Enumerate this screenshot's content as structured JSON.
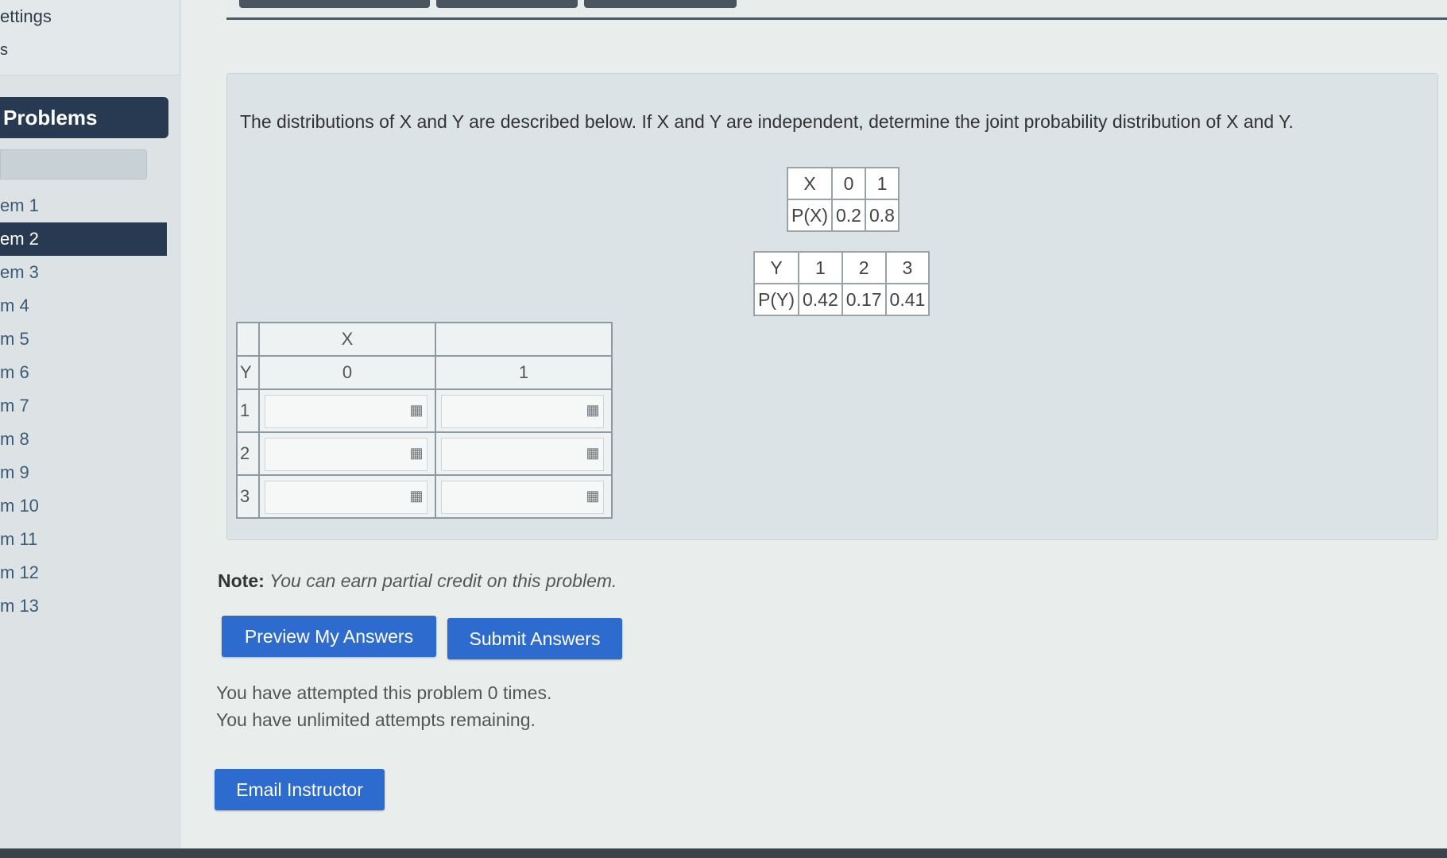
{
  "sidebar": {
    "settings_label": "ettings",
    "s_label": "s",
    "section_title": "Problems",
    "items": [
      {
        "label": "em 1",
        "active": false
      },
      {
        "label": "em 2",
        "active": true
      },
      {
        "label": "em 3",
        "active": false
      },
      {
        "label": "m 4",
        "active": false
      },
      {
        "label": "m 5",
        "active": false
      },
      {
        "label": "m 6",
        "active": false
      },
      {
        "label": "m 7",
        "active": false
      },
      {
        "label": "m 8",
        "active": false
      },
      {
        "label": "m 9",
        "active": false
      },
      {
        "label": "m 10",
        "active": false
      },
      {
        "label": "m 11",
        "active": false
      },
      {
        "label": "m 12",
        "active": false
      },
      {
        "label": "m 13",
        "active": false
      }
    ]
  },
  "problem": {
    "text": "The distributions of X and Y are described below. If X and Y are independent, determine the joint probability distribution of X and Y.",
    "x_dist": {
      "header": [
        "X",
        "0",
        "1"
      ],
      "probs": [
        "P(X)",
        "0.2",
        "0.8"
      ]
    },
    "y_dist": {
      "header": [
        "Y",
        "1",
        "2",
        "3"
      ],
      "probs": [
        "P(Y)",
        "0.42",
        "0.17",
        "0.41"
      ]
    },
    "joint_table": {
      "x_label": "X",
      "y_label": "Y",
      "x_values": [
        "0",
        "1"
      ],
      "y_values": [
        "1",
        "2",
        "3"
      ],
      "answers": [
        [
          "",
          ""
        ],
        [
          "",
          ""
        ],
        [
          "",
          ""
        ]
      ],
      "palette_icon": "grid-icon"
    }
  },
  "note": {
    "label": "Note:",
    "text": "You can earn partial credit on this problem."
  },
  "buttons": {
    "preview": "Preview My Answers",
    "submit": "Submit Answers",
    "email": "Email Instructor"
  },
  "attempts": {
    "line1": "You have attempted this problem 0 times.",
    "line2": "You have unlimited attempts remaining."
  },
  "colors": {
    "button": "#2d6bcf",
    "sidebar_active": "#283a52"
  }
}
